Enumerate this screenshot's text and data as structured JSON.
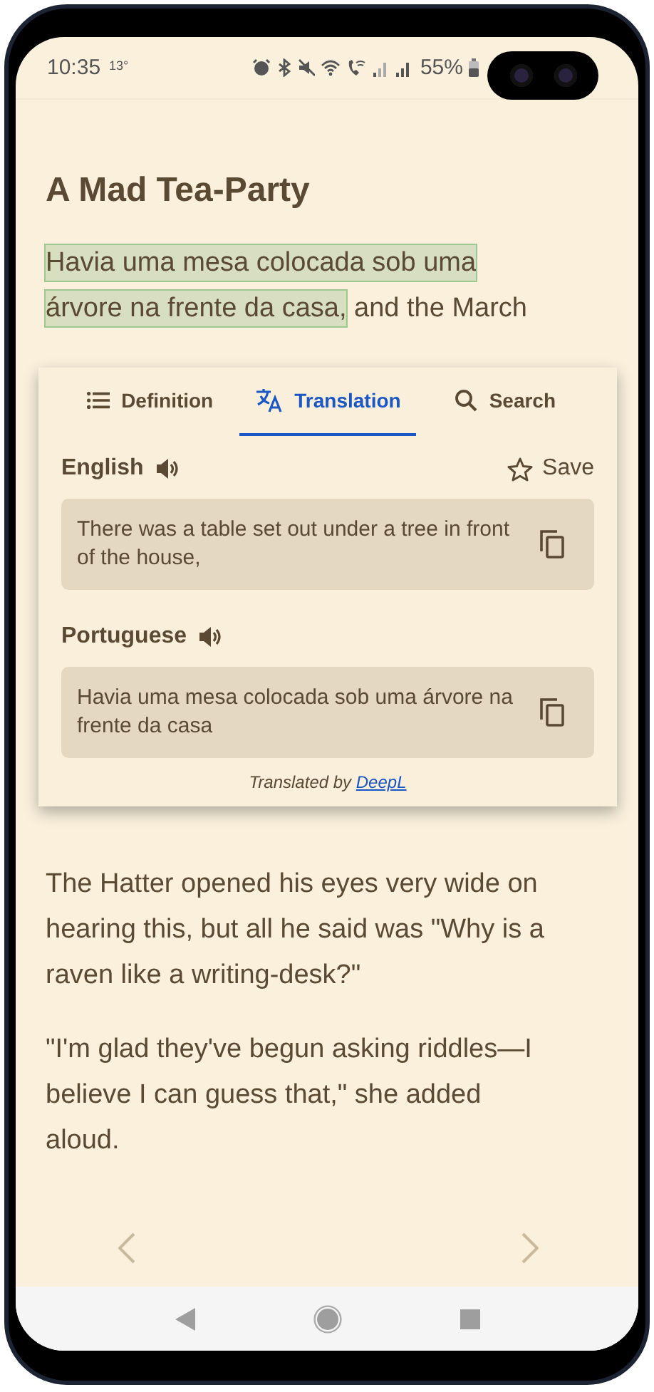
{
  "status_bar": {
    "time": "10:35",
    "temperature": "13°",
    "battery": "55%"
  },
  "title": "A Mad Tea-Party",
  "opening_paragraph": {
    "highlighted": "Havia uma mesa colocada sob uma árvore na frente da casa,",
    "rest": " and the March"
  },
  "popup": {
    "tabs": [
      {
        "kind": "definition",
        "label": "Definition",
        "selected": false
      },
      {
        "kind": "translation",
        "label": "Translation",
        "selected": true
      },
      {
        "kind": "search",
        "label": "Search",
        "selected": false
      }
    ],
    "sections": [
      {
        "language": "English",
        "save": "Save",
        "text": "There was a table set out under a tree in front of the house,"
      },
      {
        "language": "Portuguese",
        "text": "Havia uma mesa colocada sob uma árvore na frente da casa"
      }
    ],
    "credit": {
      "prefix": "Translated by ",
      "link": "DeepL"
    }
  },
  "paragraphs": [
    "The Hatter opened his eyes very wide on hearing this, but all he said was \"Why is a raven like a writing-desk?\"",
    "\"I'm glad they've begun asking riddles—I believe I can guess that,\" she added aloud."
  ]
}
